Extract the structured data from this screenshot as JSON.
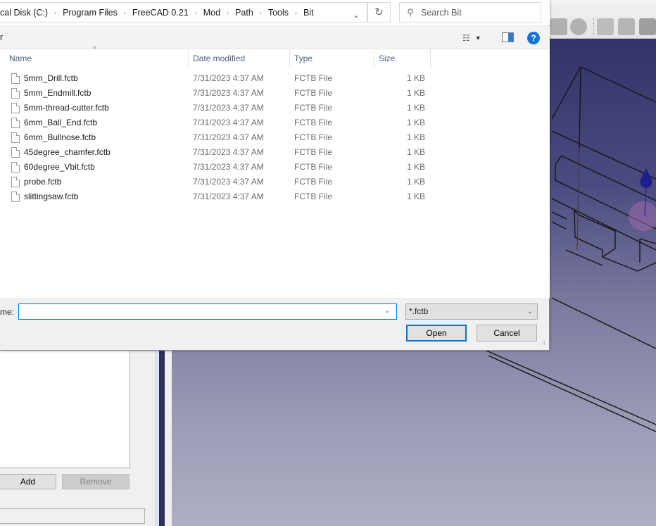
{
  "dialog": {
    "breadcrumb": [
      "cal Disk (C:)",
      "Program Files",
      "FreeCAD 0.21",
      "Mod",
      "Path",
      "Tools",
      "Bit"
    ],
    "crumb_separator": "›",
    "address_dropdown_glyph": "⌄",
    "refresh_glyph": "↻",
    "search": {
      "icon": "⚲",
      "placeholder": "Search Bit"
    },
    "organize_label": "r",
    "view_icon_glyph": "☷",
    "view_caret_glyph": "▼",
    "help_glyph": "?",
    "columns": {
      "name": "Name",
      "date": "Date modified",
      "type": "Type",
      "size": "Size"
    },
    "sort_caret_glyph": "^",
    "files": [
      {
        "name": "5mm_Drill.fctb",
        "date": "7/31/2023 4:37 AM",
        "type": "FCTB File",
        "size": "1 KB"
      },
      {
        "name": "5mm_Endmill.fctb",
        "date": "7/31/2023 4:37 AM",
        "type": "FCTB File",
        "size": "1 KB"
      },
      {
        "name": "5mm-thread-cutter.fctb",
        "date": "7/31/2023 4:37 AM",
        "type": "FCTB File",
        "size": "1 KB"
      },
      {
        "name": "6mm_Ball_End.fctb",
        "date": "7/31/2023 4:37 AM",
        "type": "FCTB File",
        "size": "1 KB"
      },
      {
        "name": "6mm_Bullnose.fctb",
        "date": "7/31/2023 4:37 AM",
        "type": "FCTB File",
        "size": "1 KB"
      },
      {
        "name": "45degree_chamfer.fctb",
        "date": "7/31/2023 4:37 AM",
        "type": "FCTB File",
        "size": "1 KB"
      },
      {
        "name": "60degree_Vbit.fctb",
        "date": "7/31/2023 4:37 AM",
        "type": "FCTB File",
        "size": "1 KB"
      },
      {
        "name": "probe.fctb",
        "date": "7/31/2023 4:37 AM",
        "type": "FCTB File",
        "size": "1 KB"
      },
      {
        "name": "slittingsaw.fctb",
        "date": "7/31/2023 4:37 AM",
        "type": "FCTB File",
        "size": "1 KB"
      }
    ],
    "filename_label": "me:",
    "filename_value": "",
    "filename_dropdown_glyph": "⌄",
    "filter_value": "*.fctb",
    "filter_caret_glyph": "⌄",
    "open_label": "Open",
    "cancel_label": "Cancel",
    "resize_grip_glyph": "⠿"
  },
  "background_app": {
    "add_label": "Add",
    "remove_label": "Remove"
  },
  "colors": {
    "accent": "#0078d7",
    "help": "#1574d4",
    "viewport_top": "#33336a",
    "viewport_bottom": "#aeaec4",
    "splitter": "#2e2e5f"
  }
}
